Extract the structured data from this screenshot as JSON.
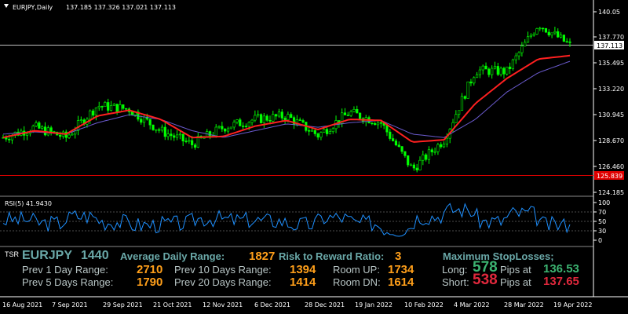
{
  "chart_header": {
    "symbol_tf": "EURJPY,Daily",
    "ohlc": "137.185 137.326 137.021 137.113"
  },
  "price_axis": {
    "ticks": [
      "140.05",
      "137.770",
      "135.495",
      "133.220",
      "130.945",
      "128.670",
      "126.460",
      "124.185"
    ],
    "current_price": "137.113",
    "stop_level": "125.839"
  },
  "rsi": {
    "label": "RSI(5) 41.9430",
    "ticks": [
      "100",
      "70",
      "50",
      "30",
      "0"
    ]
  },
  "panel": {
    "tsr": "TSR",
    "symbol": "EURJPY",
    "timeframe": "1440",
    "adr_label": "Average Daily Range:",
    "adr_value": "1827",
    "rr_label": "Risk to Reward Ratio:",
    "rr_value": "3",
    "max_sl_label": "Maximum StopLosses;",
    "prev1_label": "Prev 1 Day Range:",
    "prev1_value": "2710",
    "prev10_label": "Prev 10 Days Range:",
    "prev10_value": "1394",
    "room_up_label": "Room UP:",
    "room_up_value": "1734",
    "long_label": "Long:",
    "long_pips": "578",
    "pips_at_1": "Pips at",
    "long_price": "136.53",
    "prev5_label": "Prev 5 Days Range:",
    "prev5_value": "1790",
    "prev20_label": "Prev 20 Days Range:",
    "prev20_value": "1414",
    "room_dn_label": "Room DN:",
    "room_dn_value": "1614",
    "short_label": "Short:",
    "short_pips": "538",
    "pips_at_2": "Pips at",
    "short_price": "137.65"
  },
  "time_axis": [
    "16 Aug 2021",
    "7 Sep 2021",
    "29 Sep 2021",
    "21 Oct 2021",
    "12 Nov 2021",
    "6 Dec 2021",
    "28 Dec 2021",
    "19 Jan 2022",
    "10 Feb 2022",
    "4 Mar 2022",
    "28 Mar 2022",
    "19 Apr 2022"
  ],
  "colors": {
    "bull_candle": "#00ff00",
    "ema_fast": "#ff0000",
    "ema_slow": "#6a5acd",
    "rsi_line": "#1e90ff",
    "orange": "#ff9f1a",
    "green_value": "#3cb371",
    "red_value": "#e0283c"
  },
  "chart_data": {
    "type": "candlestick",
    "title": "EURJPY,Daily",
    "ylim": [
      124.185,
      140.05
    ],
    "x": [
      "16 Aug 2021",
      "7 Sep 2021",
      "29 Sep 2021",
      "21 Oct 2021",
      "12 Nov 2021",
      "6 Dec 2021",
      "28 Dec 2021",
      "19 Jan 2022",
      "10 Feb 2022",
      "4 Mar 2022",
      "28 Mar 2022",
      "19 Apr 2022"
    ],
    "series": [
      {
        "values": [
          129.0,
          129.9,
          129.0,
          131.8,
          131.5,
          129.6,
          128.4,
          129.9,
          130.6,
          130.9,
          129.2,
          131.2,
          130.3,
          126.2,
          128.8,
          134.9,
          134.8,
          139.0,
          137.1
        ]
      },
      {
        "values": [
          129.0,
          129.6,
          129.3,
          130.9,
          131.4,
          130.6,
          129.0,
          129.1,
          130.0,
          130.5,
          129.7,
          130.6,
          130.5,
          128.6,
          128.8,
          132.0,
          134.2,
          135.9,
          136.2
        ]
      },
      {
        "values": [
          129.3,
          129.5,
          129.3,
          130.3,
          131.0,
          130.6,
          129.6,
          129.0,
          129.6,
          130.2,
          129.9,
          130.3,
          130.5,
          129.3,
          129.0,
          130.6,
          133.0,
          134.7,
          135.7
        ]
      }
    ],
    "rsi_range": [
      0,
      100
    ],
    "rsi_current": 41.943
  }
}
